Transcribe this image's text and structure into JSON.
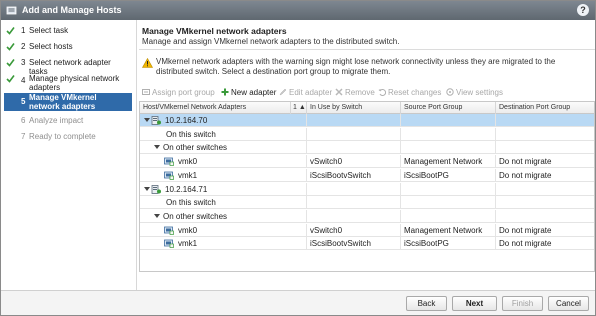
{
  "window": {
    "title": "Add and Manage Hosts",
    "help_glyph": "?"
  },
  "steps": [
    {
      "num": "1",
      "label": "Select task",
      "state": "done"
    },
    {
      "num": "2",
      "label": "Select hosts",
      "state": "done"
    },
    {
      "num": "3",
      "label": "Select network adapter tasks",
      "state": "done"
    },
    {
      "num": "4",
      "label": "Manage physical network adapters",
      "state": "done"
    },
    {
      "num": "5",
      "label": "Manage VMkernel network adapters",
      "state": "active"
    },
    {
      "num": "6",
      "label": "Analyze impact",
      "state": "todo"
    },
    {
      "num": "7",
      "label": "Ready to complete",
      "state": "todo"
    }
  ],
  "header": {
    "title": "Manage VMkernel network adapters",
    "subtitle": "Manage and assign VMkernel network adapters to the distributed switch."
  },
  "warning": {
    "text": "VMkernel network adapters with the warning sign might lose network connectivity unless they are migrated to the distributed switch. Select a destination port group to migrate them."
  },
  "toolbar": {
    "assign_port_group": "Assign port group",
    "new_adapter": "New adapter",
    "edit_adapter": "Edit adapter",
    "remove": "Remove",
    "reset_changes": "Reset changes",
    "view_settings": "View settings"
  },
  "grid": {
    "columns": [
      "Host/VMkernel Network Adapters",
      "1 ▲",
      "In Use by Switch",
      "Source Port Group",
      "Destination Port Group"
    ],
    "rows": [
      {
        "kind": "host",
        "name": "10.2.164.70",
        "switch": "",
        "source": "",
        "dest": "",
        "selected": true
      },
      {
        "kind": "group",
        "name": "On this switch",
        "switch": "",
        "source": "",
        "dest": ""
      },
      {
        "kind": "group-exp",
        "name": "On other switches",
        "switch": "",
        "source": "",
        "dest": ""
      },
      {
        "kind": "nic",
        "name": "vmk0",
        "switch": "vSwitch0",
        "source": "Management Network",
        "dest": "Do not migrate"
      },
      {
        "kind": "nic",
        "name": "vmk1",
        "switch": "iScsiBootvSwitch",
        "source": "iScsiBootPG",
        "dest": "Do not migrate"
      },
      {
        "kind": "host",
        "name": "10.2.164.71",
        "switch": "",
        "source": "",
        "dest": ""
      },
      {
        "kind": "group",
        "name": "On this switch",
        "switch": "",
        "source": "",
        "dest": ""
      },
      {
        "kind": "group-exp",
        "name": "On other switches",
        "switch": "",
        "source": "",
        "dest": ""
      },
      {
        "kind": "nic",
        "name": "vmk0",
        "switch": "vSwitch0",
        "source": "Management Network",
        "dest": "Do not migrate"
      },
      {
        "kind": "nic",
        "name": "vmk1",
        "switch": "iScsiBootvSwitch",
        "source": "iScsiBootPG",
        "dest": "Do not migrate"
      }
    ]
  },
  "footer": {
    "back": "Back",
    "next": "Next",
    "finish": "Finish",
    "cancel": "Cancel"
  },
  "colors": {
    "accent": "#2f6aa9",
    "selected_row": "#b9d9f4",
    "check": "#3a9a3a",
    "warning": "#f2b600"
  },
  "icons": {
    "title": "add-hosts-icon",
    "check": "check-icon",
    "warning": "warning-icon",
    "host": "host-icon",
    "nic": "vmkernel-adapter-icon",
    "new_adapter": "plus-icon"
  }
}
